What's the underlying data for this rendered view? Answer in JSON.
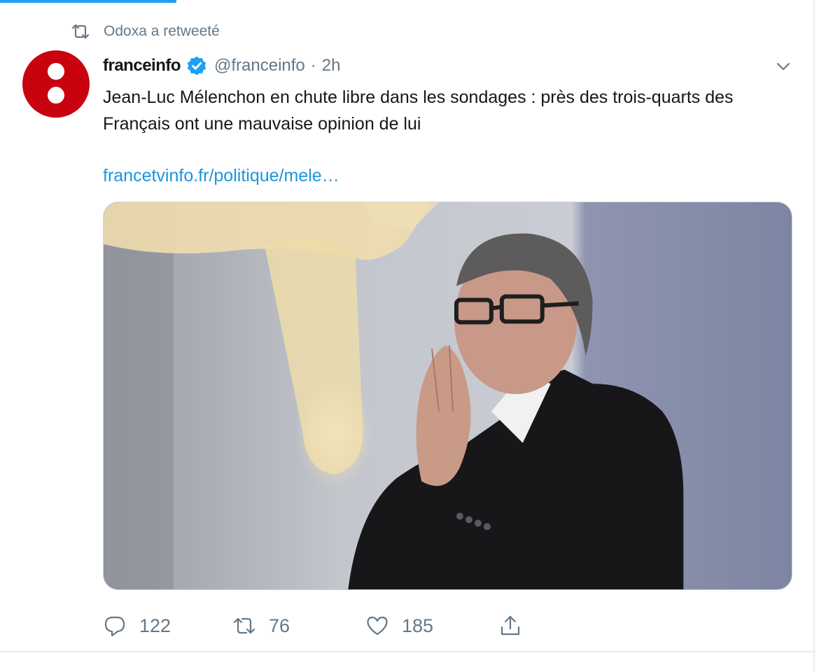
{
  "social_context": {
    "icon": "retweet-icon",
    "text": "Odoxa a retweeté"
  },
  "tweet": {
    "author": {
      "name": "franceinfo",
      "verified": true,
      "handle": "@franceinfo",
      "separator": "·",
      "time": "2h",
      "avatar_color": "#c9020f"
    },
    "text": "Jean-Luc Mélenchon en chute libre dans les sondages : près des trois-quarts des Français ont une mauvaise opinion de lui",
    "link": "francetvinfo.fr/politique/mele…",
    "media": {
      "kind": "photo",
      "subject": "man with glasses, hands pressed together, dark jacket"
    },
    "actions": {
      "reply": {
        "icon": "reply-icon",
        "count": "122"
      },
      "retweet": {
        "icon": "retweet-icon",
        "count": "76"
      },
      "like": {
        "icon": "heart-icon",
        "count": "185"
      },
      "share": {
        "icon": "share-icon"
      }
    }
  },
  "colors": {
    "accent": "#1da1f2",
    "link": "#1b95e0",
    "muted": "#657786",
    "verified": "#1da1f2"
  }
}
